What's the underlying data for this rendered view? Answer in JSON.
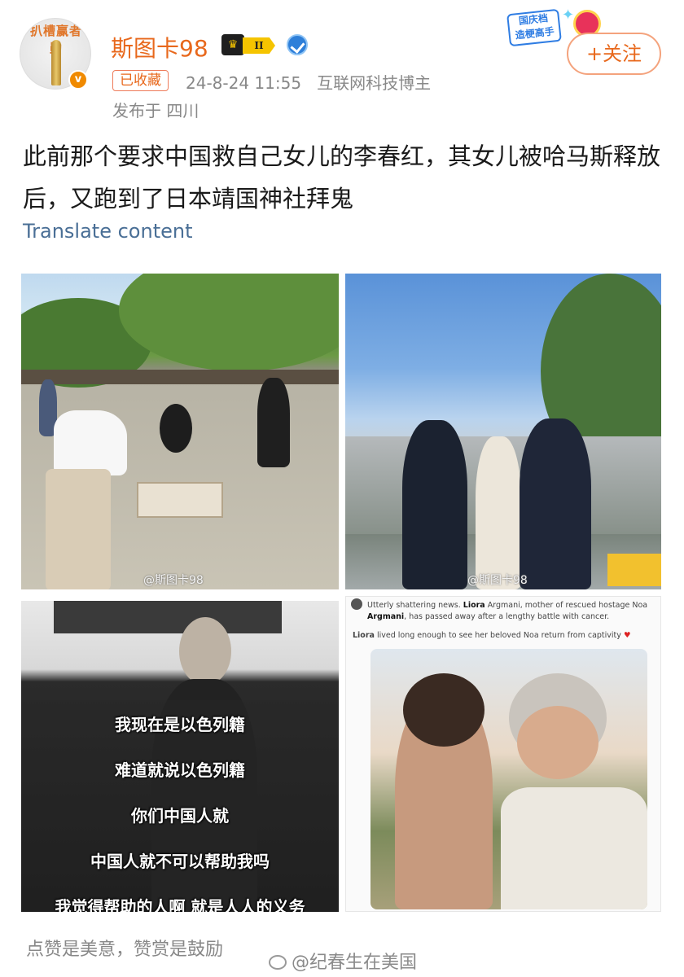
{
  "author": {
    "avatar_ring_text": "扒槽赢者勋",
    "avatar_badge": "v",
    "name": "斯图卡98",
    "level_badge": "II"
  },
  "post_meta": {
    "collected_tag": "已收藏",
    "datetime": "24-8-24 11:55",
    "category": "互联网科技博主",
    "location": "发布于 四川"
  },
  "promo_banner": {
    "line1": "国庆档",
    "line2": "造梗高手"
  },
  "follow_button": "+关注",
  "post_text": "此前那个要求中国救自己女儿的李春红，其女儿被哈马斯释放后，又跑到了日本靖国神社拜鬼",
  "translate_link": "Translate content",
  "images": {
    "watermark_1": "@斯图卡98",
    "watermark_2": "@斯图卡98",
    "subtitles": [
      "我现在是以色列籍",
      "难道就说以色列籍",
      "你们中国人就",
      "中国人就不可以帮助我吗",
      "我觉得帮助的人啊 就是人人的义务"
    ],
    "tweet_line1_pre": "Utterly shattering news. ",
    "tweet_name1": "Liora",
    "tweet_line1_mid": " Argmani, mother of rescued hostage Noa ",
    "tweet_name2": "Argmani",
    "tweet_line1_post": ", has passed away after a lengthy battle with cancer.",
    "tweet_line2_name": "Liora",
    "tweet_line2_rest": " lived long enough to see her beloved Noa return from captivity"
  },
  "footer": {
    "slogan": "点赞是美意，赞赏是鼓励",
    "watermark": "@纪春生在美国"
  },
  "colors": {
    "accent_orange": "#e8681c",
    "link_blue": "#4a6f96",
    "meta_gray": "#888888"
  }
}
